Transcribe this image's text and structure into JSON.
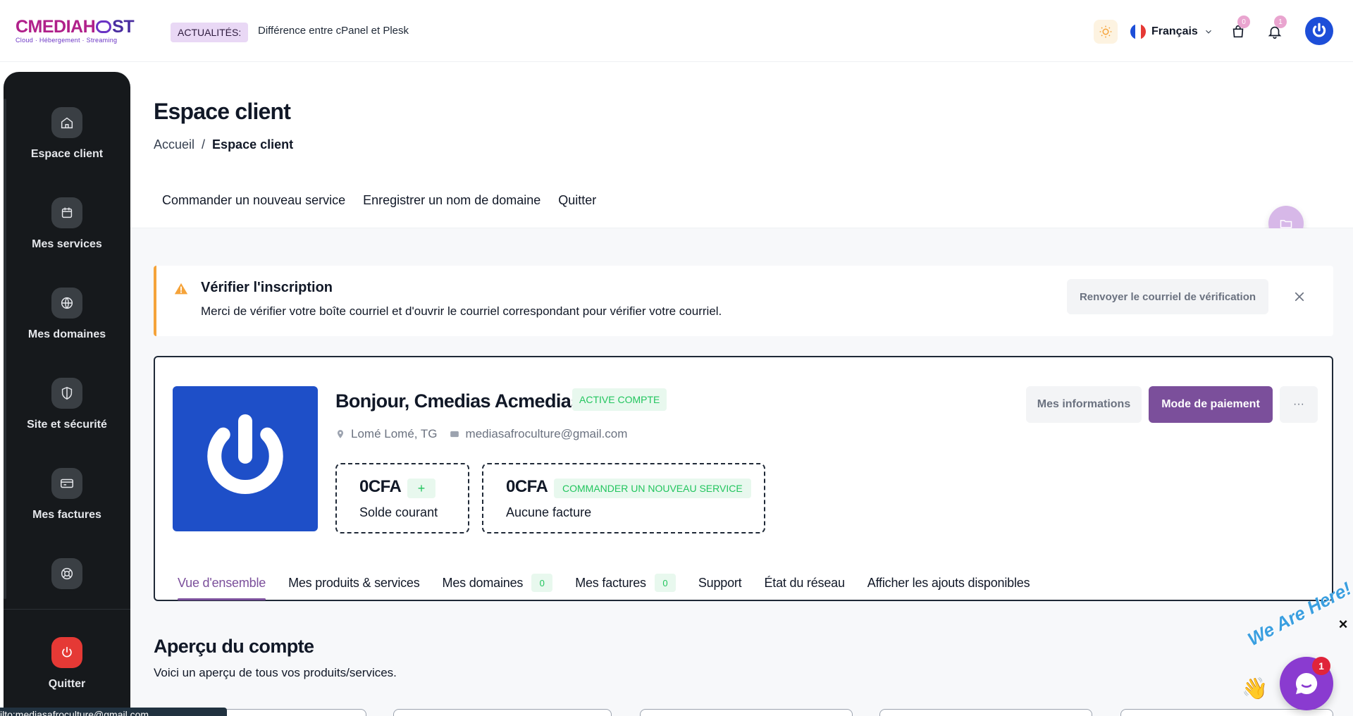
{
  "header": {
    "logo_main": "CMEDIAH",
    "logo_main_end": "ST",
    "logo_sub": "Cloud · Hébergement · Streaming",
    "news_label": "ACTUALITÉS:",
    "news_text": "Différence entre cPanel et Plesk",
    "language": "Français",
    "cart_count": "0",
    "notif_count": "1"
  },
  "sidebar": {
    "items": [
      {
        "label": "Espace client",
        "icon": "home-icon"
      },
      {
        "label": "Mes services",
        "icon": "box-icon"
      },
      {
        "label": "Mes domaines",
        "icon": "globe-icon"
      },
      {
        "label": "Site et sécurité",
        "icon": "shield-icon"
      },
      {
        "label": "Mes factures",
        "icon": "card-icon"
      },
      {
        "label": "",
        "icon": "support-icon"
      }
    ],
    "quit_label": "Quitter"
  },
  "page": {
    "title": "Espace client",
    "breadcrumb": {
      "home": "Accueil",
      "sep": "/",
      "current": "Espace client"
    },
    "sublinks": [
      "Commander un nouveau service",
      "Enregistrer un nom de domaine",
      "Quitter"
    ]
  },
  "alert": {
    "title": "Vérifier l'inscription",
    "text": "Merci de vérifier votre boîte courriel et d'ouvrir le courriel correspondant pour vérifier votre courriel.",
    "resend_label": "Renvoyer le courriel de vérification"
  },
  "profile": {
    "greeting": "Bonjour, Cmedias Acmedias",
    "status": "ACTIVE COMPTE",
    "location": "Lomé Lomé, TG",
    "email": "mediasafroculture@gmail.com",
    "balance_value": "0CFA",
    "balance_plus": "+",
    "balance_label": "Solde courant",
    "invoice_value": "0CFA",
    "invoice_chip": "COMMANDER UN NOUVEAU SERVICE",
    "invoice_label": "Aucune facture",
    "btn_info": "Mes informations",
    "btn_pay": "Mode de paiement",
    "btn_more": "···",
    "tabs": [
      {
        "label": "Vue d'ensemble",
        "count": null
      },
      {
        "label": "Mes produits & services",
        "count": null
      },
      {
        "label": "Mes domaines",
        "count": "0"
      },
      {
        "label": "Mes factures",
        "count": "0"
      },
      {
        "label": "Support",
        "count": null
      },
      {
        "label": "État du réseau",
        "count": null
      },
      {
        "label": "Afficher les ajouts disponibles",
        "count": null
      }
    ]
  },
  "overview": {
    "title": "Aperçu du compte",
    "subtitle": "Voici un aperçu de tous vos produits/services."
  },
  "status_tip": "ilto:mediasafroculture@gmail.com",
  "chat": {
    "tagline": "We Are Here!",
    "badge": "1",
    "close": "×"
  },
  "colors": {
    "accent": "#7b4f9b",
    "sidebar": "#16191c",
    "warning": "#f5a33a",
    "success": "#22c55e",
    "avatar": "#1e4fc8"
  }
}
